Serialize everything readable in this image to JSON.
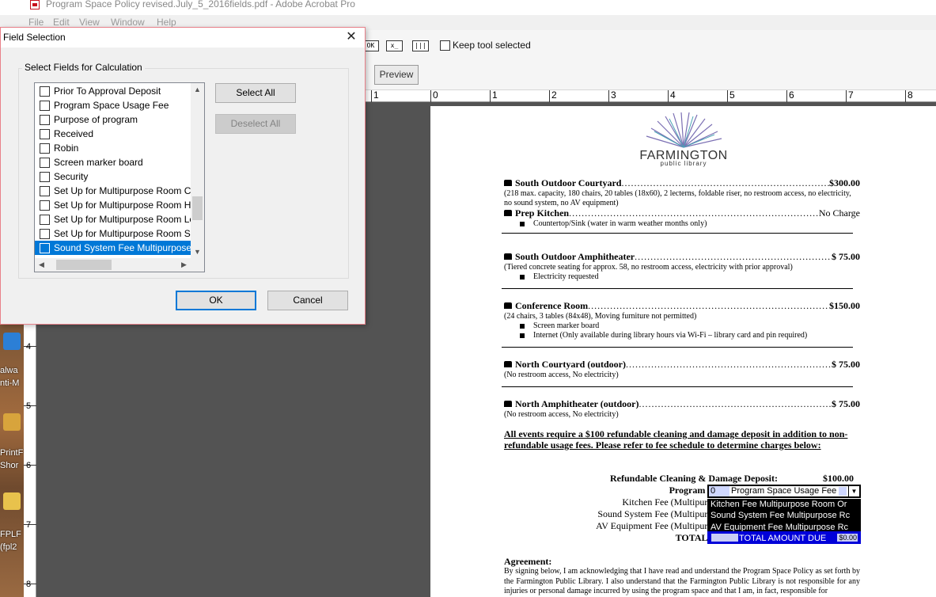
{
  "app": {
    "window_title": "Program Space Policy revised.July_5_2016fields.pdf - Adobe Acrobat Pro",
    "menu": [
      "File",
      "Edit",
      "View",
      "Window",
      "Help"
    ],
    "toolbar": {
      "keep_tool_label": "Keep tool selected",
      "preview_label": "Preview"
    },
    "ruler_top": [
      "1",
      "0",
      "1",
      "2",
      "3",
      "4",
      "5",
      "6",
      "7",
      "8"
    ],
    "ruler_left": [
      "4",
      "5",
      "6",
      "7",
      "8"
    ],
    "desktop_labels": [
      "alwa",
      "nti-M",
      "PrintF",
      "Shor",
      "FPLF",
      "(fpl2"
    ]
  },
  "dialog": {
    "title": "Field Selection",
    "group_label": "Select Fields for Calculation",
    "fields": [
      {
        "label": "Prior To Approval Deposit",
        "checked": false,
        "selected": false
      },
      {
        "label": "Program Space Usage Fee",
        "checked": false,
        "selected": false
      },
      {
        "label": "Purpose of program",
        "checked": false,
        "selected": false
      },
      {
        "label": "Received",
        "checked": false,
        "selected": false
      },
      {
        "label": "Robin",
        "checked": false,
        "selected": false
      },
      {
        "label": "Screen marker board",
        "checked": false,
        "selected": false
      },
      {
        "label": "Security",
        "checked": false,
        "selected": false
      },
      {
        "label": "Set Up for Multipurpose Room C",
        "checked": false,
        "selected": false
      },
      {
        "label": "Set Up for Multipurpose Room H",
        "checked": false,
        "selected": false
      },
      {
        "label": "Set Up for Multipurpose Room Le",
        "checked": false,
        "selected": false
      },
      {
        "label": "Set Up for Multipurpose Room Sc",
        "checked": false,
        "selected": false
      },
      {
        "label": "Sound System Fee Multipurpose",
        "checked": false,
        "selected": true
      }
    ],
    "select_all_label": "Select All",
    "deselect_all_label": "Deselect All",
    "ok_label": "OK",
    "cancel_label": "Cancel"
  },
  "document": {
    "logo_name": "FARMINGTON",
    "logo_sub": "public library",
    "venues": [
      {
        "name": "South Outdoor Courtyard",
        "price": "$300.00",
        "note": "(218 max. capacity, 180 chairs, 20 tables (18x60), 2 lecterns, foldable riser, no restroom access, no electricity, no sound system, no AV equipment)",
        "items": []
      },
      {
        "name": "Prep Kitchen",
        "price": "No Charge",
        "note": "",
        "items": [
          "Countertop/Sink (water in warm weather months only)"
        ]
      },
      {
        "name": "South Outdoor Amphitheater",
        "price": "$ 75.00",
        "note": "(Tiered concrete seating for approx. 58, no restroom access, electricity with prior approval)",
        "items": [
          "Electricity requested"
        ]
      },
      {
        "name": "Conference Room",
        "price": "$150.00",
        "note": "(24 chairs, 3 tables (84x48), Moving furniture not permitted)",
        "items": [
          "Screen marker board",
          "Internet (Only available during library hours via Wi-Fi – library card and pin required)"
        ]
      },
      {
        "name": "North Courtyard (outdoor)",
        "price": "$ 75.00",
        "note": "(No restroom access, No electricity)",
        "items": []
      },
      {
        "name": "North Amphitheater (outdoor)",
        "price": "$ 75.00",
        "note": "(No restroom access, No electricity)",
        "items": []
      }
    ],
    "notice": "All events require a $100 refundable cleaning and damage deposit in addition to non-refundable usage fees. Please refer to fee schedule to determine charges below:",
    "fees": {
      "deposit_label": "Refundable Cleaning & Damage Deposit:",
      "deposit_value": "$100.00",
      "usage_label": "Program Space Usage Fee:",
      "usage_field_value": "0",
      "usage_field_name": "Program Space Usage Fee",
      "kitchen_label": "Kitchen Fee (Multipurpose Room Only):",
      "kitchen_field_name": "Kitchen Fee Multipurpose Room Or",
      "sound_label": "Sound System Fee (Multipurpose Room Only):",
      "sound_field_name": "Sound System Fee Multipurpose Rc",
      "av_label": "AV Equipment Fee (Multipurpose Room Only):",
      "av_field_name": "AV Equipment Fee Multipurpose Rc",
      "total_label": "TOTAL AMOUNT DUE:",
      "total_field_name": "TOTAL AMOUNT DUE",
      "total_value": "$0.00"
    },
    "agreement_title": "Agreement:",
    "agreement_text": "By signing below, I am acknowledging that I have read and understand the Program Space Policy as set forth by the Farmington Public Library. I also understand that the Farmington Public Library is not responsible for any injuries or personal damage incurred by using the program space and that I am, in fact, responsible for"
  }
}
